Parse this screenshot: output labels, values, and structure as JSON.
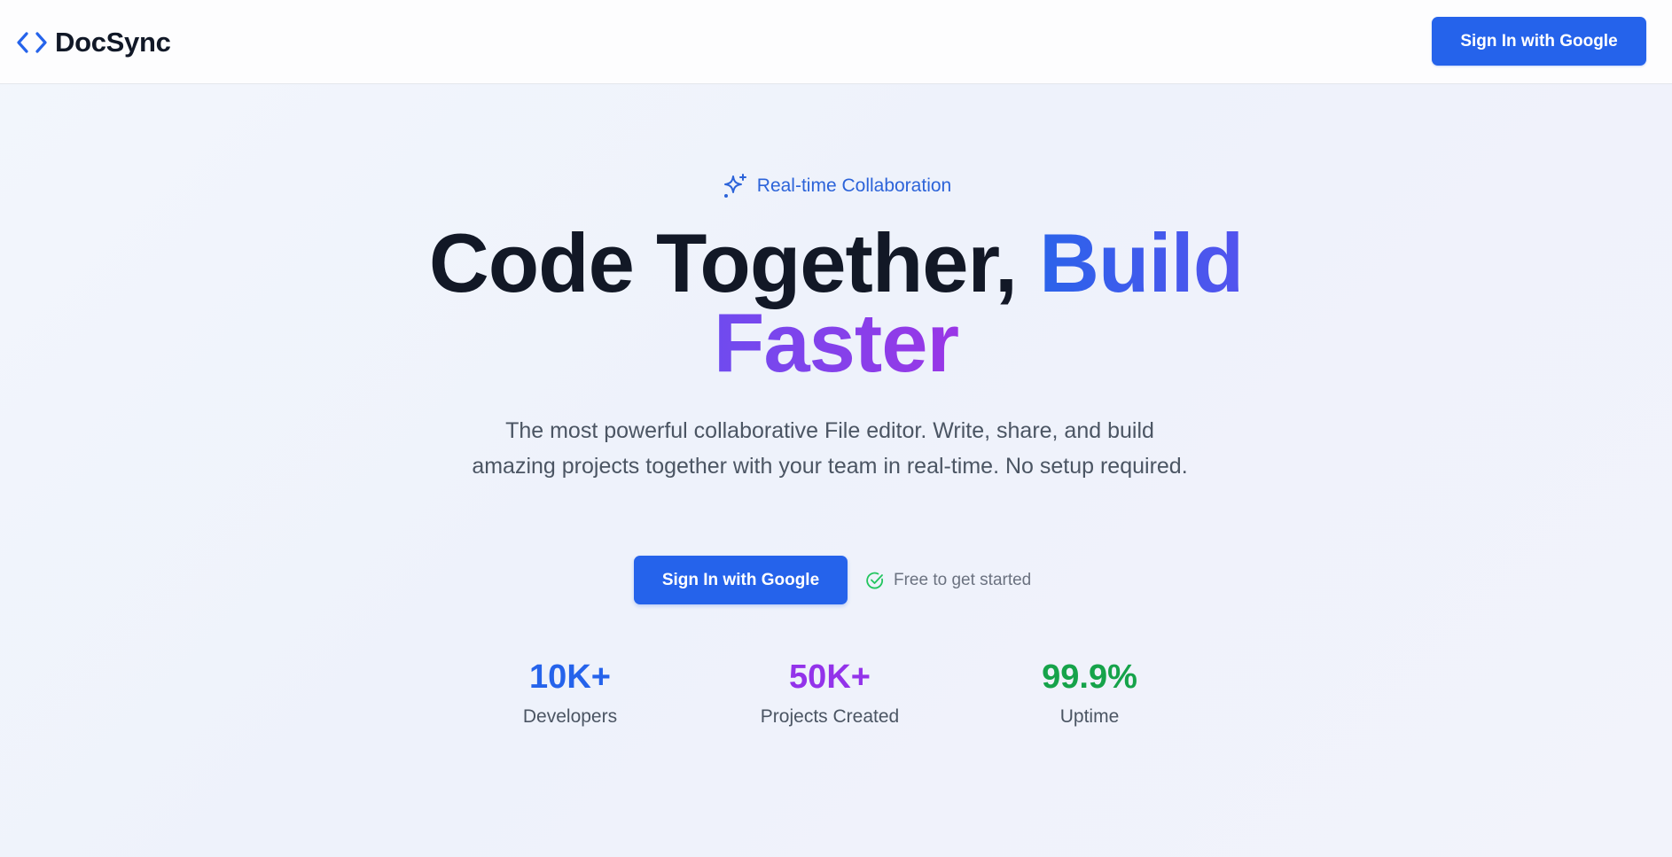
{
  "header": {
    "brand_name": "DocSync",
    "brand_icon": "code-brackets-icon",
    "signin_label": "Sign In with Google"
  },
  "hero": {
    "badge_text": "Real-time Collaboration",
    "badge_icon": "sparkles-icon",
    "headline_part1": "Code Together,",
    "headline_build": "Build",
    "headline_faster": "Faster",
    "subtitle": "The most powerful collaborative File editor. Write, share, and build amazing projects together with your team in real-time. No setup required.",
    "cta_label": "Sign In with Google",
    "free_note": "Free to get started",
    "free_icon": "check-circle-icon"
  },
  "stats": [
    {
      "value": "10K+",
      "label": "Developers",
      "color": "#2563eb"
    },
    {
      "value": "50K+",
      "label": "Projects Created",
      "color": "#9333ea"
    },
    {
      "value": "99.9%",
      "label": "Uptime",
      "color": "#16a34a"
    }
  ],
  "colors": {
    "primary": "#2563eb",
    "heading": "#121826",
    "gradient_start": "#2f63ea",
    "gradient_end": "#9b36e6",
    "success": "#22c55e"
  }
}
